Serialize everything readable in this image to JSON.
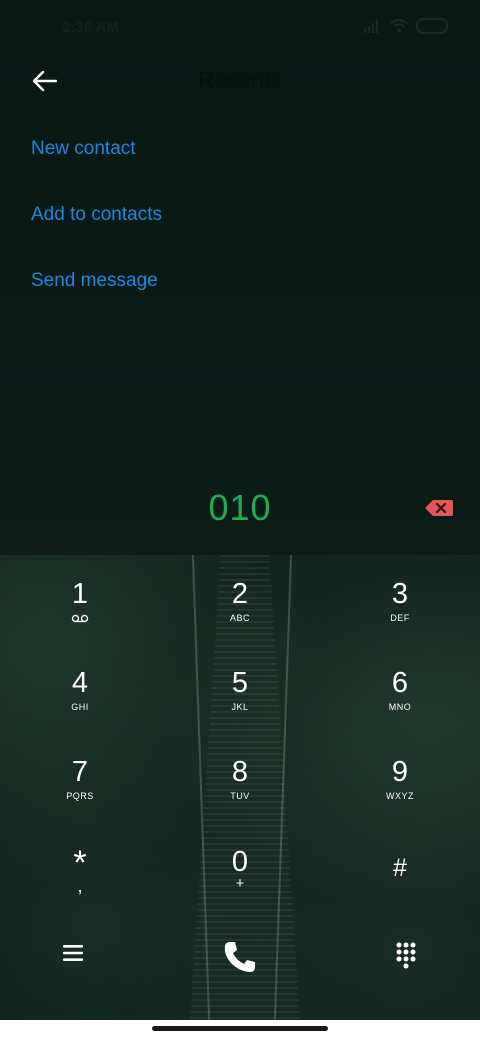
{
  "status_bar": {
    "time": "2:36 AM"
  },
  "header": {
    "title": "Recents"
  },
  "actions": [
    {
      "label": "New contact"
    },
    {
      "label": "Add to contacts"
    },
    {
      "label": "Send message"
    }
  ],
  "dialer": {
    "number": "010",
    "keys": [
      {
        "digit": "1",
        "sub": ""
      },
      {
        "digit": "2",
        "sub": "ABC"
      },
      {
        "digit": "3",
        "sub": "DEF"
      },
      {
        "digit": "4",
        "sub": "GHI"
      },
      {
        "digit": "5",
        "sub": "JKL"
      },
      {
        "digit": "6",
        "sub": "MNO"
      },
      {
        "digit": "7",
        "sub": "PQRS"
      },
      {
        "digit": "8",
        "sub": "TUV"
      },
      {
        "digit": "9",
        "sub": "WXYZ"
      },
      {
        "digit": "*",
        "sub": ","
      },
      {
        "digit": "0",
        "sub": "+"
      },
      {
        "digit": "#",
        "sub": ""
      }
    ]
  },
  "icons": {
    "back": "arrow-left-icon",
    "delete": "backspace-icon",
    "voicemail": "voicemail-icon",
    "menu": "menu-icon",
    "call": "phone-icon",
    "keypad": "dialpad-icon"
  },
  "colors": {
    "accent": "#1e88e5",
    "number": "#1fae55",
    "delete": "#e05a5a"
  }
}
